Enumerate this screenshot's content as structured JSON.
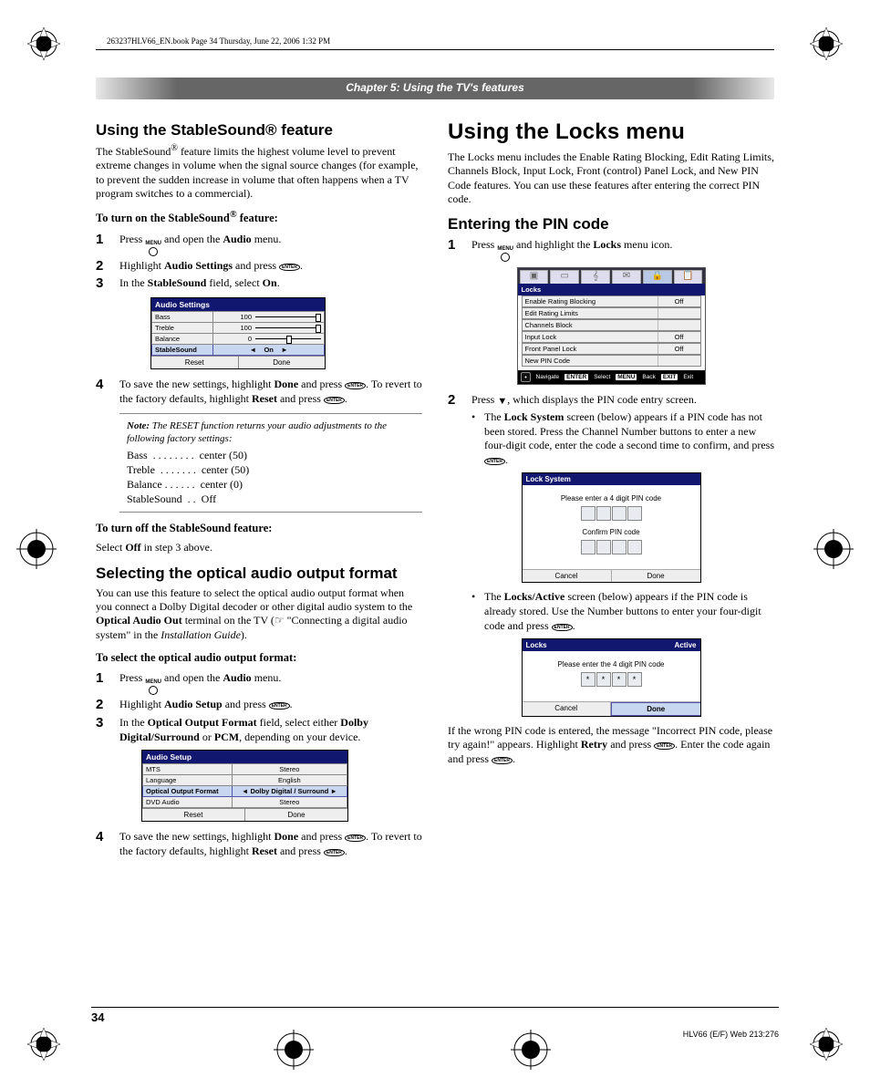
{
  "running_head": "263237HLV66_EN.book  Page 34  Thursday, June 22, 2006  1:32 PM",
  "chapter_title": "Chapter 5: Using the TV's features",
  "left": {
    "h1": "Using the StableSound® feature",
    "p1a": "The StableSound",
    "p1b": " feature limits the highest volume level to prevent extreme changes in volume when the signal source changes (for example, to prevent the sudden increase in volume that often happens when a TV program switches to a commercial).",
    "lead1a": "To turn on the StableSound",
    "lead1b": " feature:",
    "s1": {
      "1a": "Press ",
      "1b": " and open the ",
      "1c": "Audio",
      "1d": " menu.",
      "2a": "Highlight ",
      "2b": "Audio Settings",
      "2c": " and press ",
      "3a": "In the ",
      "3b": "StableSound",
      "3c": " field, select ",
      "3d": "On",
      "4a": "To save the new settings, highlight ",
      "4b": "Done",
      "4c": " and press ",
      "4d": ". To revert to the factory defaults, highlight ",
      "4e": "Reset",
      "4f": " and press "
    },
    "osd1": {
      "title": "Audio Settings",
      "rows": [
        {
          "label": "Bass",
          "val": "100"
        },
        {
          "label": "Treble",
          "val": "100"
        },
        {
          "label": "Balance",
          "val": "0"
        },
        {
          "label": "StableSound",
          "val": "On"
        }
      ],
      "btn_reset": "Reset",
      "btn_done": "Done"
    },
    "note": {
      "lead_a": "Note:",
      "lead_b": " The RESET function returns your audio adjustments to the following factory settings:",
      "list": "Bass  . . . . . . . .  center (50)\nTreble  . . . . . . .  center (50)\nBalance . . . . . .  center (0)\nStableSound  . .  Off"
    },
    "lead2": "To turn off the StableSound feature:",
    "p2a": "Select ",
    "p2b": "Off",
    "p2c": " in step 3 above.",
    "h2": "Selecting the optical audio output format",
    "p3a": "You can use this feature to select the optical audio output format when you connect a Dolby Digital decoder or other digital audio system to the ",
    "p3b": "Optical Audio Out",
    "p3c": " terminal on the TV (",
    "p3d": " \"Connecting a digital audio system\" in the ",
    "p3e": "Installation Guide",
    "p3f": ").",
    "lead3": "To select the optical audio output format:",
    "s2": {
      "1a": "Press ",
      "1b": " and open the ",
      "1c": "Audio",
      "1d": " menu.",
      "2a": "Highlight ",
      "2b": "Audio Setup",
      "2c": " and press ",
      "3a": "In the ",
      "3b": "Optical Output Format",
      "3c": " field, select either ",
      "3d": "Dolby Digital/Surround",
      "3e": " or ",
      "3f": "PCM",
      "3g": ", depending on your device.",
      "4a": "To save the new settings, highlight ",
      "4b": "Done",
      "4c": " and press ",
      "4d": ". To revert to the factory defaults, highlight ",
      "4e": "Reset",
      "4f": " and press "
    },
    "osd2": {
      "title": "Audio Setup",
      "rows": [
        {
          "label": "MTS",
          "val": "Stereo"
        },
        {
          "label": "Language",
          "val": "English"
        },
        {
          "label": "Optical Output Format",
          "val": "Dolby Digital / Surround"
        },
        {
          "label": "DVD Audio",
          "val": "Stereo"
        }
      ],
      "btn_reset": "Reset",
      "btn_done": "Done"
    }
  },
  "right": {
    "h1": "Using the Locks menu",
    "p1": "The Locks menu includes the Enable Rating Blocking, Edit Rating Limits, Channels Block, Input Lock, Front (control) Panel Lock, and New PIN Code features. You can use these features after entering the correct PIN code.",
    "h2": "Entering the PIN code",
    "s1_1a": "Press ",
    "s1_1b": " and highlight the ",
    "s1_1c": "Locks",
    "s1_1d": " menu icon.",
    "osd1": {
      "tabs": [
        "▣",
        "▭",
        "𝄞",
        "✉",
        "🔒",
        "📋"
      ],
      "title": "Locks",
      "rows": [
        {
          "l": "Enable Rating Blocking",
          "v": "Off"
        },
        {
          "l": "Edit Rating Limits",
          "v": ""
        },
        {
          "l": "Channels Block",
          "v": ""
        },
        {
          "l": "Input Lock",
          "v": "Off"
        },
        {
          "l": "Front Panel Lock",
          "v": "Off"
        },
        {
          "l": "New PIN Code",
          "v": ""
        }
      ],
      "nav": {
        "navigate": "Navigate",
        "select": "Select",
        "back": "Back",
        "exit": "Exit",
        "k1": "ENTER",
        "k2": "MENU",
        "k3": "EXIT"
      }
    },
    "s2_2a": "Press ",
    "s2_2b": ", which displays the PIN code entry screen.",
    "b1a": "The ",
    "b1b": "Lock System",
    "b1c": " screen (below) appears if a PIN code has not been stored. Press the Channel Number buttons to enter a new four-digit code, enter the code a second time to confirm, and press ",
    "osd2": {
      "title": "Lock System",
      "line1": "Please enter a 4 digit PIN code",
      "line2": "Confirm PIN code",
      "cancel": "Cancel",
      "done": "Done"
    },
    "b2a": "The ",
    "b2b": "Locks/Active",
    "b2c": " screen (below) appears if the PIN code is already stored. Use the Number buttons to enter your four-digit code and press ",
    "osd3": {
      "title_l": "Locks",
      "title_r": "Active",
      "line1": "Please enter the 4 digit PIN code",
      "stars": "****",
      "cancel": "Cancel",
      "done": "Done"
    },
    "p2a": "If the wrong PIN code is entered, the message \"Incorrect PIN code, please try again!\" appears. Highlight ",
    "p2b": "Retry",
    "p2c": " and press ",
    "p2d": ". Enter the code again and press "
  },
  "menu_label": "MENU",
  "enter_label": "ENTER",
  "page_number": "34",
  "footer_right": "HLV66 (E/F) Web 213:276"
}
